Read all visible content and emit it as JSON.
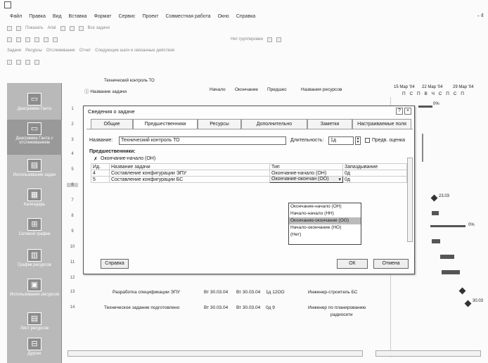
{
  "window": {
    "control_glyph": "- ₫"
  },
  "menu": [
    "Файл",
    "Правка",
    "Вид",
    "Вставка",
    "Формат",
    "Сервис",
    "Проект",
    "Совместная работа",
    "Окно",
    "Справка"
  ],
  "toolbar1": {
    "show": "Показать",
    "font": "Arial",
    "filter": "Все задачи"
  },
  "toolbar2": {
    "grouping": "Нет группировки"
  },
  "toolbar3": {
    "items": [
      "Задачи",
      "Ресурсы",
      "Отслеживание",
      "Отчет",
      "Следующие шаги и связанные действия"
    ]
  },
  "sheet": {
    "current_task": "Технический контроль ТО",
    "headers": {
      "name": "Название задачи",
      "start": "Начало",
      "finish": "Окончание",
      "pred": "Предшес",
      "resources": "Названия ресурсов"
    },
    "timescale": [
      "15 Мар '04",
      "22 Мар '04",
      "29 Мар '04"
    ],
    "days": "П С П В Ч С П С П",
    "rows": [
      "1",
      "2",
      "3",
      "4",
      "5",
      "6",
      "7",
      "8",
      "9",
      "10",
      "11",
      "12",
      "13",
      "14"
    ],
    "task13": {
      "name": "Разработка спецификации ЭПУ",
      "start": "Вт 30.03.04",
      "finish": "Вт 30.03.04",
      "pred": "1д 12ОО",
      "resource": "Инженер-строитель БС"
    },
    "task14": {
      "name": "Техническое задание подготовлено",
      "start": "Вт 30.03.04",
      "finish": "Вт 30.03.04",
      "pred": "0д 9",
      "resource": "Инженер по планированию",
      "resource2": "радиосети"
    },
    "gantt_labels": {
      "pct1": "0%",
      "date1": "23.03",
      "pct2": "0%",
      "date2": "30.03"
    }
  },
  "viewbar": [
    "Диаграмма Ганта",
    "Диаграмма Ганта с отслеживанием",
    "Использование задач",
    "Календарь",
    "Сетевой график",
    "График ресурсов",
    "Использование ресурсов",
    "Лист ресурсов",
    "Другие"
  ],
  "dialog": {
    "title": "Сведения о задаче",
    "tabs": [
      "Общие",
      "Предшественники",
      "Ресурсы",
      "Дополнительно",
      "Заметки",
      "Настраиваемые поля"
    ],
    "name_label": "Название:",
    "name_value": "Технический контроль ТО",
    "duration_label": "Длительность:",
    "duration_value": "1д",
    "estimate_label": "Предв. оценка",
    "predecessors_label": "Предшественники:",
    "edit_value": "Окончание-начало (ОН)",
    "columns": {
      "id": "Ид.",
      "name": "Название задачи",
      "type": "Тип",
      "lag": "Запаздывание"
    },
    "rows": [
      {
        "id": "4",
        "name": "Составление конфигурации ЭПУ",
        "type": "Окончание-начало (ОН)",
        "lag": "0д"
      },
      {
        "id": "5",
        "name": "Составление конфигурации БС",
        "type": "Окончание-окончан (ОО)",
        "lag": "0д"
      }
    ],
    "dropdown_options": [
      "Окончание-начало (ОН)",
      "Начало-начало (НН)",
      "Окончание-окончание (ОО)",
      "Начало-окончание (НО)",
      "(Нет)"
    ],
    "help": "Справка",
    "ok": "ОК",
    "cancel": "Отмена"
  }
}
